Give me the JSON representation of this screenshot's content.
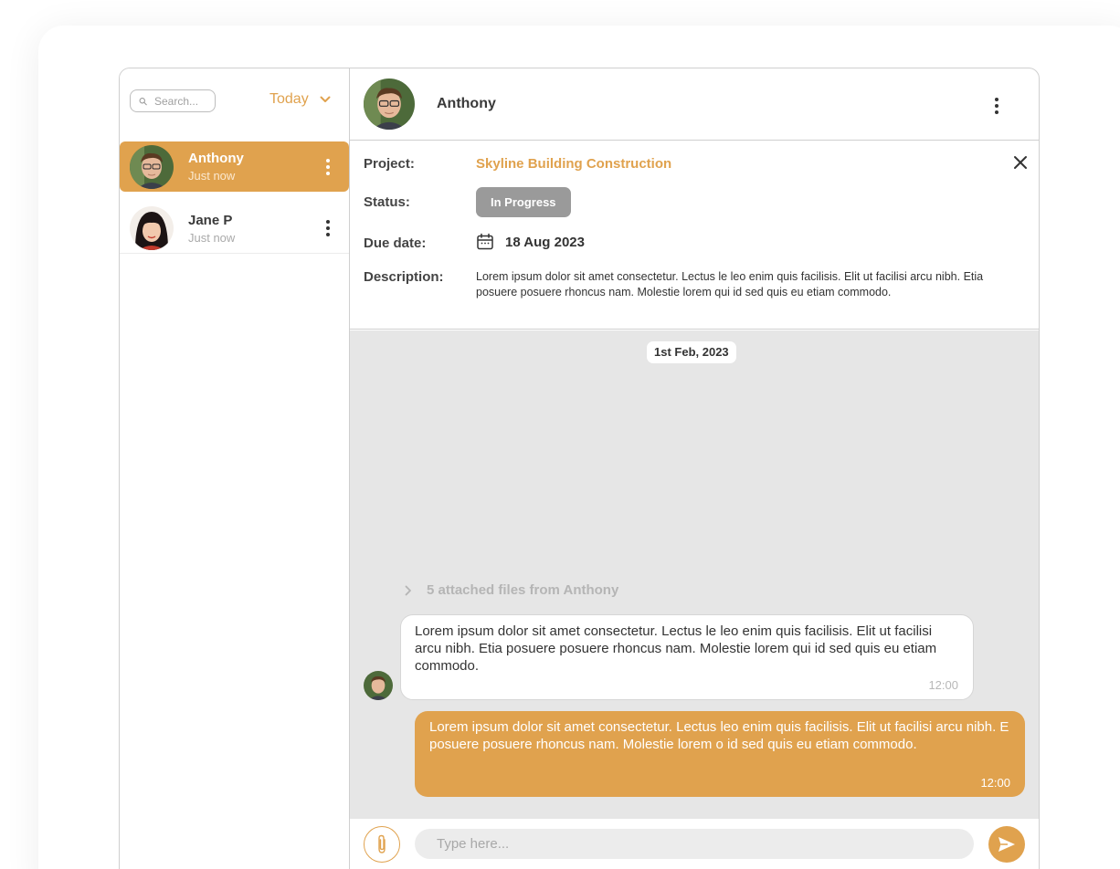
{
  "sidebar": {
    "search_placeholder": "Search...",
    "filter_label": "Today",
    "contacts": [
      {
        "name": "Anthony",
        "time": "Just now",
        "active": true
      },
      {
        "name": "Jane P",
        "time": "Just now",
        "active": false
      }
    ]
  },
  "header": {
    "name": "Anthony"
  },
  "details": {
    "project_label": "Project:",
    "project_value": "Skyline Building Construction",
    "status_label": "Status:",
    "status_value": "In Progress",
    "due_label": "Due date:",
    "due_value": "18 Aug 2023",
    "description_label": "Description:",
    "description_value": "Lorem ipsum dolor sit amet consectetur. Lectus le leo enim quis facilisis. Elit ut facilisi arcu nibh. Etia posuere posuere rhoncus nam. Molestie lorem qui id sed quis eu etiam commodo."
  },
  "chat": {
    "date_separator": "1st Feb, 2023",
    "attachments_label": "5 attached files from Anthony",
    "messages": [
      {
        "direction": "incoming",
        "text": "Lorem ipsum dolor sit amet consectetur. Lectus le leo enim quis facilisis. Elit ut facilisi arcu nibh. Etia posuere posuere rhoncus nam. Molestie lorem qui id sed quis eu etiam commodo.",
        "time": "12:00"
      },
      {
        "direction": "outgoing",
        "text": "Lorem ipsum dolor sit amet consectetur. Lectus leo enim quis facilisis. Elit ut facilisi arcu nibh. E posuere posuere rhoncus nam. Molestie lorem o id sed quis eu etiam commodo.",
        "time": "12:00"
      }
    ]
  },
  "composer": {
    "placeholder": "Type here..."
  },
  "icons": {
    "search": "search-icon",
    "filter": "chevron-down-icon",
    "more": "more-vertical-icon",
    "close": "close-icon",
    "calendar": "calendar-icon",
    "expand": "chevron-right-icon",
    "attach": "paperclip-icon",
    "send": "send-icon"
  },
  "colors": {
    "accent": "#e0a24e",
    "status_pill": "#9a9a9a",
    "chat_background": "#e6e6e6"
  }
}
